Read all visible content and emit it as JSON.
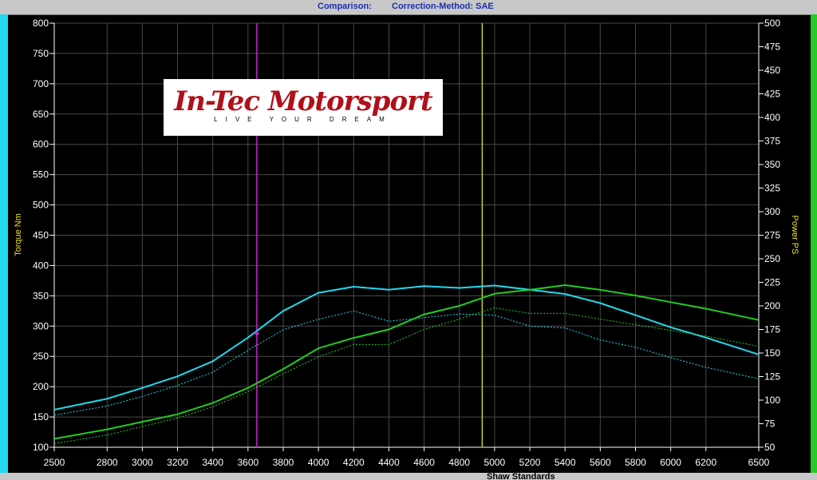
{
  "header": {
    "comparison": "Comparison:",
    "correction_method": "Correction-Method: SAE"
  },
  "footer": {
    "text": "Shaw Standards"
  },
  "logo": {
    "brand": "In-Tec Motorsport",
    "tagline": "LIVE YOUR DREAM"
  },
  "colors": {
    "background": "#000000",
    "grid": "#4a4a4a",
    "torque": "#22d8ee",
    "power": "#22cc22",
    "cursor_magenta": "#cc22cc",
    "cursor_yellow": "#c8c84a",
    "axis_label": "#e8e020"
  },
  "chart_data": {
    "type": "line",
    "x": [
      2500,
      2800,
      3000,
      3200,
      3400,
      3600,
      3800,
      4000,
      4200,
      4400,
      4600,
      4800,
      5000,
      5200,
      5400,
      5600,
      5800,
      6000,
      6200,
      6500
    ],
    "xlim": [
      2500,
      6500
    ],
    "xticks": [
      2500,
      2800,
      3000,
      3200,
      3400,
      3600,
      3800,
      4000,
      4200,
      4400,
      4600,
      4800,
      5000,
      5200,
      5400,
      5600,
      5800,
      6000,
      6200,
      6500
    ],
    "ylabel": "Torque Nm",
    "ylim": [
      100,
      800
    ],
    "yticks": [
      100,
      150,
      200,
      250,
      300,
      350,
      400,
      450,
      500,
      550,
      600,
      650,
      700,
      750,
      800
    ],
    "y2label": "Power PS",
    "y2lim": [
      50,
      500
    ],
    "y2ticks": [
      50,
      75,
      100,
      125,
      150,
      175,
      200,
      225,
      250,
      275,
      300,
      325,
      350,
      375,
      400,
      425,
      450,
      475,
      500
    ],
    "grid": true,
    "series": [
      {
        "axis": "left",
        "style": "solid",
        "color": "#22d8ee",
        "values": [
          162,
          180,
          198,
          217,
          242,
          281,
          325,
          355,
          365,
          360,
          366,
          363,
          367,
          360,
          353,
          338,
          318,
          298,
          281,
          253
        ]
      },
      {
        "axis": "left",
        "style": "dotted",
        "color": "#22d8ee",
        "values": [
          153,
          168,
          184,
          202,
          224,
          260,
          294,
          311,
          325,
          308,
          314,
          320,
          318,
          300,
          297,
          277,
          265,
          248,
          232,
          213
        ]
      },
      {
        "axis": "right",
        "style": "solid",
        "color": "#22cc22",
        "values": [
          59,
          69,
          77,
          85,
          97,
          113,
          133,
          155,
          166,
          175,
          191,
          200,
          213,
          217,
          222,
          217,
          211,
          204,
          197,
          185
        ]
      },
      {
        "axis": "right",
        "style": "dotted",
        "color": "#22cc22",
        "values": [
          54,
          63,
          72,
          81,
          93,
          109,
          128,
          146,
          159,
          159,
          175,
          186,
          198,
          192,
          192,
          186,
          180,
          174,
          168,
          157
        ]
      }
    ],
    "cursors": [
      {
        "x": 3650,
        "color": "#cc22cc"
      },
      {
        "x": 4930,
        "color": "#c8c84a"
      }
    ]
  }
}
